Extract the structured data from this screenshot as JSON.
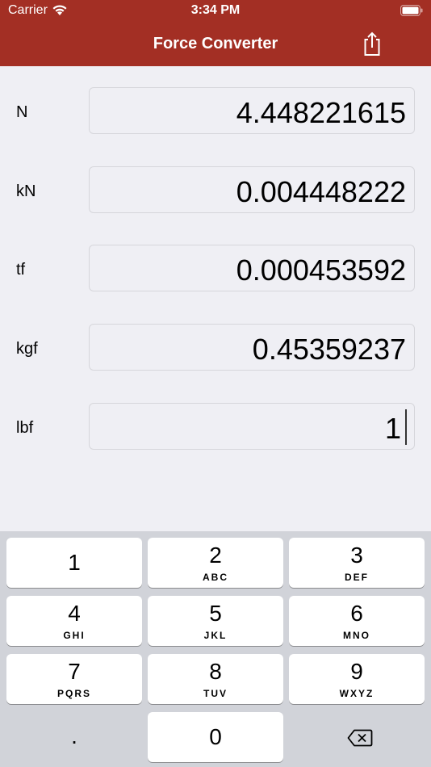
{
  "status_bar": {
    "carrier": "Carrier",
    "time": "3:34 PM"
  },
  "nav": {
    "title": "Force Converter",
    "share_icon": "share-icon"
  },
  "rows": [
    {
      "unit": "N",
      "value": "4.448221615"
    },
    {
      "unit": "kN",
      "value": "0.004448222"
    },
    {
      "unit": "tf",
      "value": "0.000453592"
    },
    {
      "unit": "kgf",
      "value": "0.45359237"
    },
    {
      "unit": "lbf",
      "value": "1"
    }
  ],
  "keyboard": {
    "keys": [
      {
        "digit": "1",
        "letters": ""
      },
      {
        "digit": "2",
        "letters": "ABC"
      },
      {
        "digit": "3",
        "letters": "DEF"
      },
      {
        "digit": "4",
        "letters": "GHI"
      },
      {
        "digit": "5",
        "letters": "JKL"
      },
      {
        "digit": "6",
        "letters": "MNO"
      },
      {
        "digit": "7",
        "letters": "PQRS"
      },
      {
        "digit": "8",
        "letters": "TUV"
      },
      {
        "digit": "9",
        "letters": "WXYZ"
      }
    ],
    "decimal": ".",
    "zero": "0",
    "delete_icon": "delete-backspace-icon"
  },
  "colors": {
    "header": "#a32f24",
    "background": "#efeff4",
    "keyboard": "#d1d3d9"
  }
}
